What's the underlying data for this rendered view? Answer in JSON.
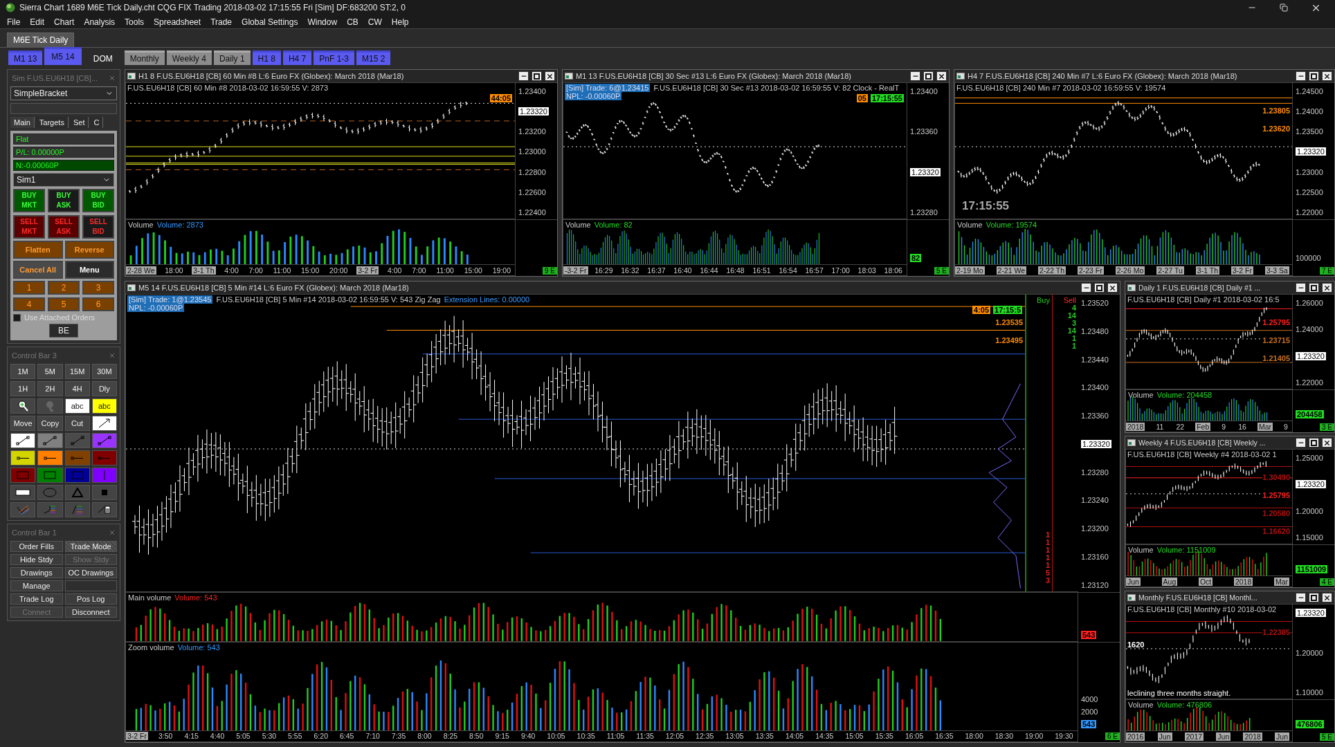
{
  "window": {
    "title": "Sierra Chart 1689 M6E Tick Daily.cht  CQG FIX Trading 2018-03-02  17:15:55 Fri [Sim]  DF:683200  ST:2, 0"
  },
  "menu": [
    "File",
    "Edit",
    "Chart",
    "Analysis",
    "Tools",
    "Spreadsheet",
    "Trade",
    "Global Settings",
    "Window",
    "CB",
    "CW",
    "Help"
  ],
  "chartbook_tabs": [
    {
      "label": "M6E Tick Daily",
      "selected": true
    }
  ],
  "chart_tabs": [
    {
      "label": "M1 13",
      "kind": "tab",
      "color": "#5a5af0",
      "selected": false
    },
    {
      "label": "M5 14",
      "kind": "tab",
      "color": "#5a5af0",
      "selected": true
    },
    {
      "label": "DOM",
      "kind": "plain",
      "selected": false
    },
    {
      "label": "Monthly",
      "kind": "tab",
      "color": "#8c8c8c",
      "selected": false
    },
    {
      "label": "Weekly 4",
      "kind": "tab",
      "color": "#8c8c8c",
      "selected": false
    },
    {
      "label": "Daily 1",
      "kind": "tab",
      "color": "#8c8c8c",
      "selected": false
    },
    {
      "label": "H1 8",
      "kind": "tab",
      "color": "#5a5af0",
      "selected": false
    },
    {
      "label": "H4 7",
      "kind": "tab",
      "color": "#5a5af0",
      "selected": false
    },
    {
      "label": "PnF 1-3",
      "kind": "tab",
      "color": "#5a5af0",
      "selected": false
    },
    {
      "label": "M15 2",
      "kind": "tab",
      "color": "#5a5af0",
      "selected": false
    }
  ],
  "trade_window": {
    "title": "Sim F.US.EU6H18 [CB]...",
    "strategy": "SimpleBracket",
    "tabs": [
      {
        "label": "Main",
        "selected": true
      },
      {
        "label": "Targets",
        "selected": false
      },
      {
        "label": "Set",
        "selected": false
      },
      {
        "label": "C",
        "selected": false
      }
    ],
    "status": [
      {
        "text": "Flat",
        "kind": "plain"
      },
      {
        "text": "P/L: 0.00000P",
        "kind": "plain"
      },
      {
        "text": "N:-0.00060P",
        "kind": "net"
      }
    ],
    "account": "Sim1",
    "order_buttons": [
      {
        "label": "BUY MKT",
        "kind": "buy"
      },
      {
        "label": "BUY ASK",
        "kind": "buy-alt"
      },
      {
        "label": "BUY BID",
        "kind": "buy"
      },
      {
        "label": "SELL MKT",
        "kind": "sell"
      },
      {
        "label": "SELL ASK",
        "kind": "sell"
      },
      {
        "label": "SELL BID",
        "kind": "sell-alt"
      }
    ],
    "action_buttons": [
      {
        "label": "Flatten",
        "kind": "orange"
      },
      {
        "label": "Reverse",
        "kind": "orange"
      },
      {
        "label": "Cancel All",
        "kind": "cancel"
      },
      {
        "label": "Menu",
        "kind": "plain"
      }
    ],
    "quantity_buttons": [
      "1",
      "2",
      "3",
      "4",
      "5",
      "6"
    ],
    "attached_orders": {
      "label": "Use Attached Orders",
      "checked": false
    },
    "be_button": "BE"
  },
  "control_bar_3": {
    "title": "Control Bar 3",
    "tools": [
      {
        "kind": "text",
        "label": "1M"
      },
      {
        "kind": "text",
        "label": "5M"
      },
      {
        "kind": "text",
        "label": "15M"
      },
      {
        "kind": "text",
        "label": "30M"
      },
      {
        "kind": "text",
        "label": "1H"
      },
      {
        "kind": "text",
        "label": "2H"
      },
      {
        "kind": "text",
        "label": "4H"
      },
      {
        "kind": "text",
        "label": "Dly"
      },
      {
        "kind": "zoom"
      },
      {
        "kind": "pointer"
      },
      {
        "kind": "abc",
        "label": "abc",
        "color": "#ffffff"
      },
      {
        "kind": "abc",
        "label": "abc",
        "color": "#ffff00"
      },
      {
        "kind": "text",
        "label": "Move"
      },
      {
        "kind": "text",
        "label": "Copy"
      },
      {
        "kind": "text",
        "label": "Cut"
      },
      {
        "kind": "arrow",
        "color": "#ffffff"
      },
      {
        "kind": "line",
        "color": "#ffffff"
      },
      {
        "kind": "line",
        "color": "#808080"
      },
      {
        "kind": "line",
        "color": "#4a4a4a"
      },
      {
        "kind": "line",
        "color": "#9933ff"
      },
      {
        "kind": "marker",
        "color": "#d4d400"
      },
      {
        "kind": "marker",
        "color": "#ff8000"
      },
      {
        "kind": "marker",
        "color": "#804000"
      },
      {
        "kind": "marker",
        "color": "#800000"
      },
      {
        "kind": "rect",
        "color": "#800000"
      },
      {
        "kind": "rect",
        "color": "#008000"
      },
      {
        "kind": "rect",
        "color": "#000099"
      },
      {
        "kind": "vline",
        "color": "#8000ff"
      },
      {
        "kind": "bar"
      },
      {
        "kind": "ellipse"
      },
      {
        "kind": "triangle"
      },
      {
        "kind": "square"
      },
      {
        "kind": "fan"
      },
      {
        "kind": "fib"
      },
      {
        "kind": "fib-alt"
      },
      {
        "kind": "calc"
      }
    ]
  },
  "control_bar_1": {
    "title": "Control Bar 1",
    "buttons": [
      {
        "label": "Order Fills",
        "on": false,
        "disabled": false
      },
      {
        "label": "Trade Mode",
        "on": true,
        "disabled": false
      },
      {
        "label": "Hide Stdy",
        "on": false,
        "disabled": false
      },
      {
        "label": "Show Stdy",
        "on": false,
        "disabled": true
      },
      {
        "label": "Drawings",
        "on": false,
        "disabled": false
      },
      {
        "label": "OC Drawings",
        "on": false,
        "disabled": false
      },
      {
        "label": "Manage",
        "on": false,
        "disabled": false
      },
      {
        "kind": "blank"
      },
      {
        "label": "Trade Log",
        "on": false,
        "disabled": false
      },
      {
        "label": "Pos Log",
        "on": false,
        "disabled": false
      },
      {
        "label": "Connect",
        "on": false,
        "disabled": true
      },
      {
        "label": "Disconnect",
        "on": false,
        "disabled": false
      }
    ]
  },
  "charts": [
    {
      "title": "H1 8  F.US.EU6H18 [CB]  60 Min  #8  L:6  Euro FX (Globex): March 2018 (Mar18)",
      "info_lines": [
        [
          {
            "text": "F.US.EU6H18 [CB]  60 Min  #8 2018-03-02 16:59:55 V: 2873",
            "kind": "plain"
          }
        ]
      ],
      "badges": [
        {
          "text": "44:05",
          "color": "#ff8c00"
        }
      ],
      "price_ticks": [
        {
          "label": "1.23400",
          "kind": "tick"
        },
        {
          "label": "1.23320",
          "kind": "current"
        },
        {
          "label": "1.23200",
          "kind": "tick"
        },
        {
          "label": "1.23000",
          "kind": "tick"
        },
        {
          "label": "1.22800",
          "kind": "tick"
        },
        {
          "label": "1.22600",
          "kind": "tick"
        },
        {
          "label": "1.22400",
          "kind": "tick"
        }
      ],
      "panes": [
        {
          "label": "Volume",
          "value": "Volume: 2873",
          "color": "#3399ff"
        }
      ],
      "time_ticks": [
        {
          "label": "2-28 We",
          "boxed": true
        },
        {
          "label": "18:00",
          "boxed": false
        },
        {
          "label": "3-1 Th",
          "boxed": true
        },
        {
          "label": "4:00",
          "boxed": false
        },
        {
          "label": "7:00",
          "boxed": false
        },
        {
          "label": "11:00",
          "boxed": false
        },
        {
          "label": "15:00",
          "boxed": false
        },
        {
          "label": "20:00",
          "boxed": false
        },
        {
          "label": "3-2 Fr",
          "boxed": true
        },
        {
          "label": "4:00",
          "boxed": false
        },
        {
          "label": "7:00",
          "boxed": false
        },
        {
          "label": "11:00",
          "boxed": false
        },
        {
          "label": "15:00",
          "boxed": false
        },
        {
          "label": "19:00",
          "boxed": false
        }
      ],
      "corner": "9 E"
    },
    {
      "title": "M1 13  F.US.EU6H18 [CB]  30 Sec  #13  L:6  Euro FX (Globex): March 2018 (Mar18)",
      "info_lines": [
        [
          {
            "text": "[Sim]  Trade: 6@1.23415",
            "kind": "sim"
          },
          {
            "text": "F.US.EU6H18 [CB]  30 Sec  #13 2018-03-02 16:59:55 V: 82 Clock - RealT",
            "kind": "plain"
          }
        ],
        [
          {
            "text": "NPL: -0.00060P",
            "kind": "sim"
          }
        ]
      ],
      "badges": [
        {
          "text": "05",
          "color": "#ff8c00"
        },
        {
          "text": "17:15:55",
          "color": "#22dd22"
        }
      ],
      "price_ticks": [
        {
          "label": "1.23400",
          "kind": "tick"
        },
        {
          "label": "1.23360",
          "kind": "tick"
        },
        {
          "label": "1.23320",
          "kind": "current"
        },
        {
          "label": "1.23280",
          "kind": "tick"
        }
      ],
      "panes": [
        {
          "label": "Volume",
          "value": "Volume: 82",
          "color": "#22dd22",
          "badges": [
            {
              "text": "82",
              "color": "#22dd22"
            }
          ]
        }
      ],
      "time_ticks": [
        {
          "label": "-3-2 Fr",
          "boxed": true
        },
        {
          "label": "16:29",
          "boxed": false
        },
        {
          "label": "16:32",
          "boxed": false
        },
        {
          "label": "16:37",
          "boxed": false
        },
        {
          "label": "16:40",
          "boxed": false
        },
        {
          "label": "16:44",
          "boxed": false
        },
        {
          "label": "16:48",
          "boxed": false
        },
        {
          "label": "16:51",
          "boxed": false
        },
        {
          "label": "16:54",
          "boxed": false
        },
        {
          "label": "16:57",
          "boxed": false
        },
        {
          "label": "17:00",
          "boxed": false
        },
        {
          "label": "18:03",
          "boxed": false
        },
        {
          "label": "18:06",
          "boxed": false
        }
      ],
      "corner": "5 E"
    },
    {
      "title": "H4 7  F.US.EU6H18 [CB]  240 Min  #7  L:6  Euro FX (Globex): March 2018 (Mar18)",
      "info_lines": [
        [
          {
            "text": "F.US.EU6H18 [CB]  240 Min  #7 2018-03-02 16:59:55 V: 19574",
            "kind": "plain"
          }
        ]
      ],
      "levels": [
        {
          "text": "1.23805",
          "color": "#ff8c00"
        },
        {
          "text": "1.23620",
          "color": "#ff8c00"
        }
      ],
      "notes": [
        {
          "text": "17:15:55",
          "kind": "clock"
        }
      ],
      "price_ticks": [
        {
          "label": "1.24500",
          "kind": "tick"
        },
        {
          "label": "1.24000",
          "kind": "tick"
        },
        {
          "label": "1.23500",
          "kind": "tick"
        },
        {
          "label": "1.23320",
          "kind": "current"
        },
        {
          "label": "1.23000",
          "kind": "tick"
        },
        {
          "label": "1.22500",
          "kind": "tick"
        },
        {
          "label": "1.22000",
          "kind": "tick"
        }
      ],
      "panes": [
        {
          "label": "Volume",
          "value": "Volume: 19574",
          "color": "#22dd22",
          "ticks": [
            "100000"
          ]
        }
      ],
      "time_ticks": [
        {
          "label": "2-19 Mo",
          "boxed": true
        },
        {
          "label": "2-21 We",
          "boxed": true
        },
        {
          "label": "2-22 Th",
          "boxed": true
        },
        {
          "label": "2-23 Fr",
          "boxed": true
        },
        {
          "label": "2-26 Mo",
          "boxed": true
        },
        {
          "label": "2-27 Tu",
          "boxed": true
        },
        {
          "label": "3-1 Th",
          "boxed": true
        },
        {
          "label": "3-2 Fr",
          "boxed": true
        },
        {
          "label": "3-3 Sa",
          "boxed": true
        }
      ],
      "corner": "7 E"
    },
    {
      "title": "M5 14  F.US.EU6H18 [CB]  5 Min  #14  L:6  Euro FX (Globex): March 2018 (Mar18)",
      "info_lines": [
        [
          {
            "text": "[Sim]  Trade: 1@1.23545",
            "kind": "sim"
          },
          {
            "text": "F.US.EU6H18 [CB]  5 Min  #14 2018-03-02 16:59:55 V: 543 Zig Zag",
            "kind": "plain"
          },
          {
            "text": "Extension Lines: 0.00000",
            "kind": "blue"
          }
        ],
        [
          {
            "text": "NPL: -0.00060P",
            "kind": "sim"
          }
        ]
      ],
      "badges": [
        {
          "text": "4:05",
          "color": "#ff8c00"
        },
        {
          "text": "17:15:5",
          "color": "#22dd22"
        }
      ],
      "levels": [
        {
          "text": "1.23535",
          "color": "#ff8c00"
        },
        {
          "text": "1.23495",
          "color": "#ff8c00"
        }
      ],
      "dom": {
        "buy": "Buy",
        "sell": "Sell",
        "sell_entries": [
          {
            "text": "4",
            "color": "#22cc22"
          },
          {
            "text": "14",
            "color": "#22cc22"
          },
          {
            "text": "3",
            "color": "#22cc22"
          },
          {
            "text": "14",
            "color": "#22cc22"
          },
          {
            "text": "1",
            "color": "#22cc22"
          },
          {
            "text": "1",
            "color": "#22cc22"
          }
        ],
        "buy_entries": [
          {
            "text": "1",
            "color": "#e02020"
          },
          {
            "text": "1",
            "color": "#e02020"
          },
          {
            "text": "1",
            "color": "#e02020"
          },
          {
            "text": "1",
            "color": "#e02020"
          },
          {
            "text": "1",
            "color": "#e02020"
          },
          {
            "text": "5",
            "color": "#e02020"
          },
          {
            "text": "3",
            "color": "#e02020"
          }
        ]
      },
      "price_ticks": [
        {
          "label": "1.23520",
          "kind": "tick"
        },
        {
          "label": "1.23480",
          "kind": "tick"
        },
        {
          "label": "1.23440",
          "kind": "tick"
        },
        {
          "label": "1.23400",
          "kind": "tick"
        },
        {
          "label": "1.23360",
          "kind": "tick"
        },
        {
          "label": "1.23320",
          "kind": "current"
        },
        {
          "label": "1.23280",
          "kind": "tick"
        },
        {
          "label": "1.23240",
          "kind": "tick"
        },
        {
          "label": "1.23200",
          "kind": "tick"
        },
        {
          "label": "1.23160",
          "kind": "tick"
        },
        {
          "label": "1.23120",
          "kind": "tick"
        }
      ],
      "panes": [
        {
          "label": "Main volume",
          "value": "Volume: 543",
          "color": "#ff2020",
          "badges": [
            {
              "text": "543",
              "color": "#ff2020"
            }
          ]
        },
        {
          "label": "Zoom volume",
          "value": "Volume: 543",
          "color": "#3399ff",
          "ticks": [
            "4000",
            "2000"
          ],
          "badges": [
            {
              "text": "543",
              "color": "#3399ff"
            }
          ]
        }
      ],
      "time_ticks": [
        {
          "label": "3-2 Fr",
          "boxed": true
        },
        {
          "label": "3:50",
          "boxed": false
        },
        {
          "label": "4:15",
          "boxed": false
        },
        {
          "label": "4:40",
          "boxed": false
        },
        {
          "label": "5:05",
          "boxed": false
        },
        {
          "label": "5:30",
          "boxed": false
        },
        {
          "label": "5:55",
          "boxed": false
        },
        {
          "label": "6:20",
          "boxed": false
        },
        {
          "label": "6:45",
          "boxed": false
        },
        {
          "label": "7:10",
          "boxed": false
        },
        {
          "label": "7:35",
          "boxed": false
        },
        {
          "label": "8:00",
          "boxed": false
        },
        {
          "label": "8:25",
          "boxed": false
        },
        {
          "label": "8:50",
          "boxed": false
        },
        {
          "label": "9:15",
          "boxed": false
        },
        {
          "label": "9:40",
          "boxed": false
        },
        {
          "label": "10:05",
          "boxed": false
        },
        {
          "label": "10:35",
          "boxed": false
        },
        {
          "label": "11:05",
          "boxed": false
        },
        {
          "label": "11:35",
          "boxed": false
        },
        {
          "label": "12:05",
          "boxed": false
        },
        {
          "label": "12:35",
          "boxed": false
        },
        {
          "label": "13:05",
          "boxed": false
        },
        {
          "label": "13:35",
          "boxed": false
        },
        {
          "label": "14:05",
          "boxed": false
        },
        {
          "label": "14:35",
          "boxed": false
        },
        {
          "label": "15:05",
          "boxed": false
        },
        {
          "label": "15:35",
          "boxed": false
        },
        {
          "label": "16:05",
          "boxed": false
        },
        {
          "label": "16:35",
          "boxed": false
        },
        {
          "label": "18:00",
          "boxed": false
        },
        {
          "label": "18:30",
          "boxed": false
        },
        {
          "label": "19:00",
          "boxed": false
        },
        {
          "label": "19:30",
          "boxed": false
        }
      ],
      "corner": "6 E"
    },
    {
      "title": "Daily 1  F.US.EU6H18 [CB]  Daily  #1 ...",
      "info_lines": [
        [
          {
            "text": "F.US.EU6H18 [CB]  Daily  #1 2018-03-02 16:5",
            "kind": "plain"
          }
        ]
      ],
      "levels": [
        {
          "text": "1.25795",
          "color": "#ff2020"
        },
        {
          "text": "1.23715",
          "color": "#c87020"
        },
        {
          "text": "1.21405",
          "color": "#c87020"
        }
      ],
      "price_ticks": [
        {
          "label": "1.26000",
          "kind": "tick"
        },
        {
          "label": "1.24000",
          "kind": "tick"
        },
        {
          "label": "1.23320",
          "kind": "current"
        },
        {
          "label": "1.22000",
          "kind": "tick"
        }
      ],
      "panes": [
        {
          "label": "Volume",
          "value": "Volume: 204458",
          "color": "#22dd22",
          "badges": [
            {
              "text": "204458",
              "color": "#22dd22"
            }
          ]
        }
      ],
      "time_ticks": [
        {
          "label": "2018",
          "boxed": true
        },
        {
          "label": "11",
          "boxed": false
        },
        {
          "label": "22",
          "boxed": false
        },
        {
          "label": "Feb",
          "boxed": true
        },
        {
          "label": "9",
          "boxed": false
        },
        {
          "label": "16",
          "boxed": false
        },
        {
          "label": "Mar",
          "boxed": true
        },
        {
          "label": "9",
          "boxed": false
        }
      ],
      "corner": "3 E"
    },
    {
      "title": "Weekly 4  F.US.EU6H18 [CB]  Weekly ...",
      "info_lines": [
        [
          {
            "text": "F.US.EU6H18 [CB]  Weekly  #4 2018-03-02 1",
            "kind": "plain"
          }
        ]
      ],
      "levels": [
        {
          "text": "1.30490",
          "color": "#b01010"
        },
        {
          "text": "1.25795",
          "color": "#ff2020"
        },
        {
          "text": "1.20580",
          "color": "#b01010"
        },
        {
          "text": "1.16620",
          "color": "#b01010"
        }
      ],
      "price_ticks": [
        {
          "label": "1.25000",
          "kind": "tick"
        },
        {
          "label": "1.23320",
          "kind": "current"
        },
        {
          "label": "1.20000",
          "kind": "tick"
        },
        {
          "label": "1.15000",
          "kind": "tick"
        }
      ],
      "panes": [
        {
          "label": "Volume",
          "value": "Volume: 1151009",
          "color": "#22dd22",
          "badges": [
            {
              "text": "1151009",
              "color": "#22dd22"
            }
          ]
        }
      ],
      "time_ticks": [
        {
          "label": "Jun",
          "boxed": true
        },
        {
          "label": "Aug",
          "boxed": true
        },
        {
          "label": "Oct",
          "boxed": true
        },
        {
          "label": "2018",
          "boxed": true
        },
        {
          "label": "Mar",
          "boxed": true
        }
      ],
      "corner": "4 E"
    },
    {
      "title": "Monthly  F.US.EU6H18 [CB]  Monthl...",
      "info_lines": [
        [
          {
            "text": "F.US.EU6H18 [CB]  Monthly  #10 2018-03-02",
            "kind": "plain"
          }
        ]
      ],
      "levels": [
        {
          "text": "1.22385",
          "color": "#b01010"
        }
      ],
      "notes": [
        {
          "text": "1620",
          "kind": "label"
        },
        {
          "text": "leclining three months straight.",
          "kind": "caption"
        }
      ],
      "price_ticks": [
        {
          "label": "1.23320",
          "kind": "current"
        },
        {
          "label": "1.20000",
          "kind": "tick"
        },
        {
          "label": "1.10000",
          "kind": "tick"
        }
      ],
      "panes": [
        {
          "label": "Volume",
          "value": "Volume: 476806",
          "color": "#22dd22",
          "badges": [
            {
              "text": "476806",
              "color": "#22dd22"
            }
          ]
        }
      ],
      "time_ticks": [
        {
          "label": "2016",
          "boxed": true
        },
        {
          "label": "Jun",
          "boxed": true
        },
        {
          "label": "2017",
          "boxed": true
        },
        {
          "label": "Jun",
          "boxed": true
        },
        {
          "label": "2018",
          "boxed": true
        },
        {
          "label": "Jun",
          "boxed": true
        }
      ],
      "corner": "5 E"
    }
  ]
}
